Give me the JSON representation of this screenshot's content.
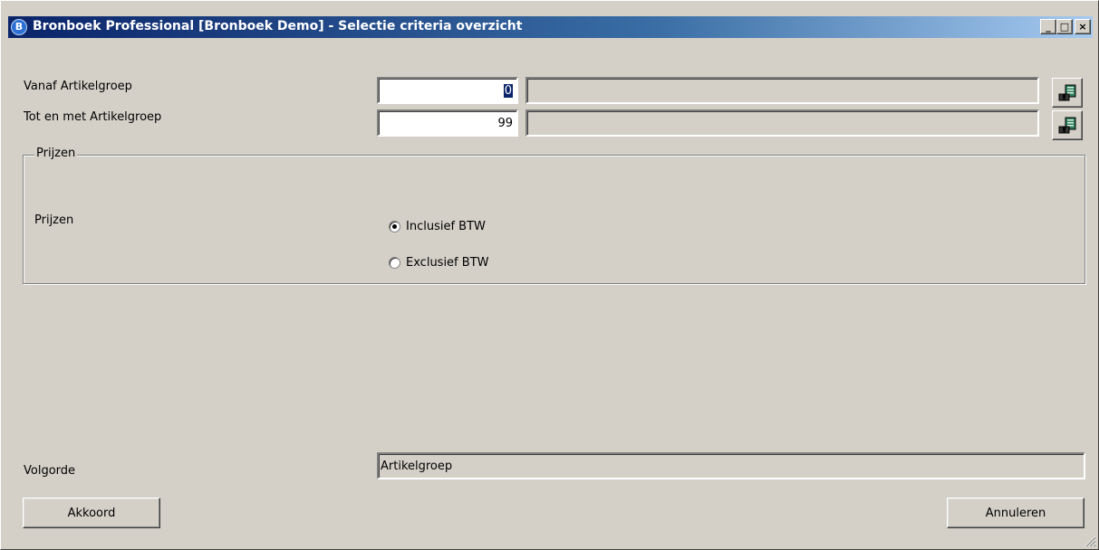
{
  "window": {
    "title": "Bronboek Professional [Bronboek Demo] - Selectie criteria overzicht",
    "app_icon_letter": "B",
    "controls": {
      "minimize": "_",
      "maximize": "□",
      "close": "×"
    }
  },
  "filters": {
    "from_group": {
      "label": "Vanaf Artikelgroep",
      "value": "0",
      "description": ""
    },
    "to_group": {
      "label": "Tot en met Artikelgroep",
      "value": "99",
      "description": ""
    }
  },
  "prices": {
    "group_title": "Prijzen",
    "label": "Prijzen",
    "options": [
      {
        "label": "Inclusief BTW",
        "selected": true
      },
      {
        "label": "Exclusief BTW",
        "selected": false
      }
    ]
  },
  "order": {
    "label": "Volgorde",
    "value": "Artikelgroep"
  },
  "buttons": {
    "ok": "Akkoord",
    "cancel": "Annuleren"
  },
  "icons": [
    "app-logo-icon",
    "minimize-icon",
    "maximize-icon",
    "close-icon",
    "lookup-search-icon",
    "resize-grip-icon"
  ]
}
